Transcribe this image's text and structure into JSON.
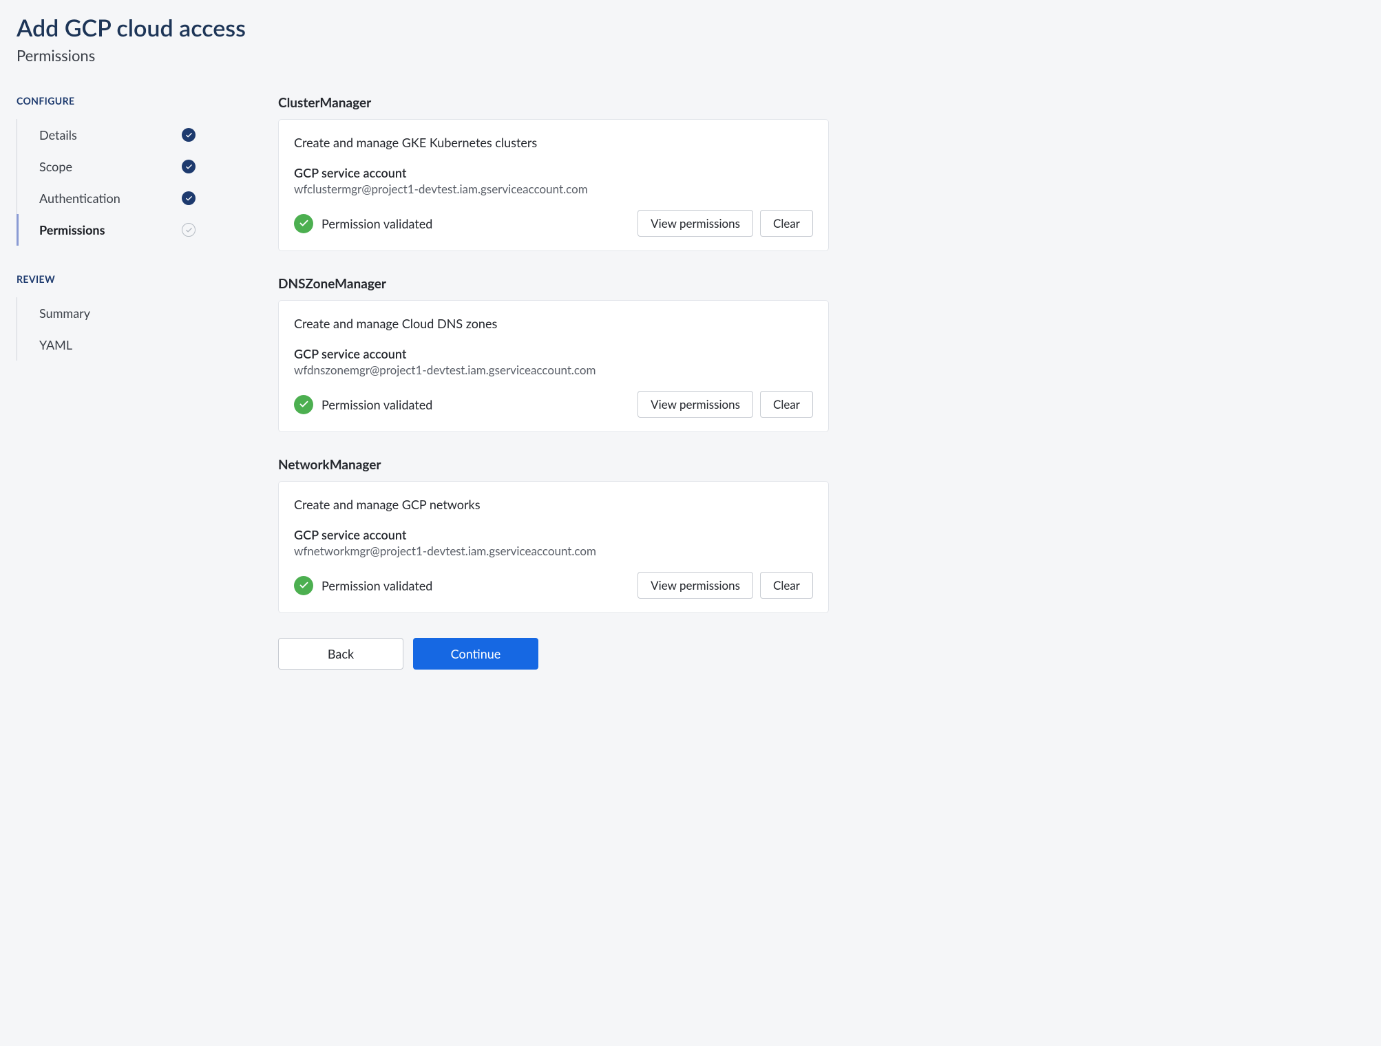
{
  "header": {
    "title": "Add GCP cloud access",
    "subtitle": "Permissions"
  },
  "sidebar": {
    "configure": {
      "label": "CONFIGURE",
      "items": [
        {
          "label": "Details",
          "state": "done"
        },
        {
          "label": "Scope",
          "state": "done"
        },
        {
          "label": "Authentication",
          "state": "done"
        },
        {
          "label": "Permissions",
          "state": "current"
        }
      ]
    },
    "review": {
      "label": "REVIEW",
      "items": [
        {
          "label": "Summary"
        },
        {
          "label": "YAML"
        }
      ]
    }
  },
  "labels": {
    "sa_label": "GCP service account",
    "status_validated": "Permission validated",
    "view_btn": "View permissions",
    "clear_btn": "Clear",
    "back_btn": "Back",
    "continue_btn": "Continue"
  },
  "permissions": [
    {
      "name": "ClusterManager",
      "description": "Create and manage GKE Kubernetes clusters",
      "service_account": "wfclustermgr@project1-devtest.iam.gserviceaccount.com"
    },
    {
      "name": "DNSZoneManager",
      "description": "Create and manage Cloud DNS zones",
      "service_account": "wfdnszonemgr@project1-devtest.iam.gserviceaccount.com"
    },
    {
      "name": "NetworkManager",
      "description": "Create and manage GCP networks",
      "service_account": "wfnetworkmgr@project1-devtest.iam.gserviceaccount.com"
    }
  ]
}
